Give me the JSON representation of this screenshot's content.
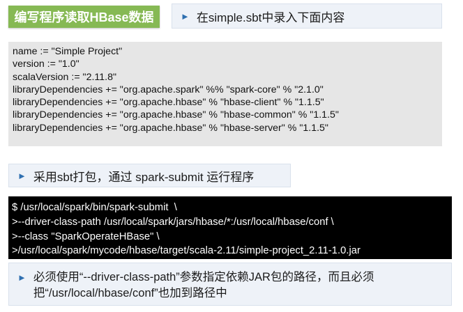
{
  "title_badge": "编写程序读取HBase数据",
  "callout_sbt": "在simple.sbt中录入下面内容",
  "sbt_lines": [
    "name := \"Simple Project\"",
    "version := \"1.0\"",
    "scalaVersion := \"2.11.8\"",
    "libraryDependencies += \"org.apache.spark\" %% \"spark-core\" % \"2.1.0\"",
    "libraryDependencies += \"org.apache.hbase\" % \"hbase-client\" % \"1.1.5\"",
    "libraryDependencies += \"org.apache.hbase\" % \"hbase-common\" % \"1.1.5\"",
    "libraryDependencies += \"org.apache.hbase\" % \"hbase-server\" % \"1.1.5\""
  ],
  "callout_package": "采用sbt打包，通过 spark-submit 运行程序",
  "command_lines": [
    "$ /usr/local/spark/bin/spark-submit  \\",
    ">--driver-class-path /usr/local/spark/jars/hbase/*:/usr/local/hbase/conf \\",
    ">--class \"SparkOperateHBase\" \\",
    ">/usr/local/spark/mycode/hbase/target/scala-2.11/simple-project_2.11-1.0.jar"
  ],
  "callout_note": "必须使用“--driver-class-path”参数指定依赖JAR包的路径，而且必须把“/usr/local/hbase/conf”也加到路径中",
  "colors": {
    "title_green": "#86b954",
    "arrow_blue": "#2f6fb0",
    "callout_bg": "#eef2f8",
    "code_gray_bg": "#e6e6e6",
    "terminal_bg": "#000000"
  },
  "icons": {
    "bullet": "triangle-right-icon"
  }
}
